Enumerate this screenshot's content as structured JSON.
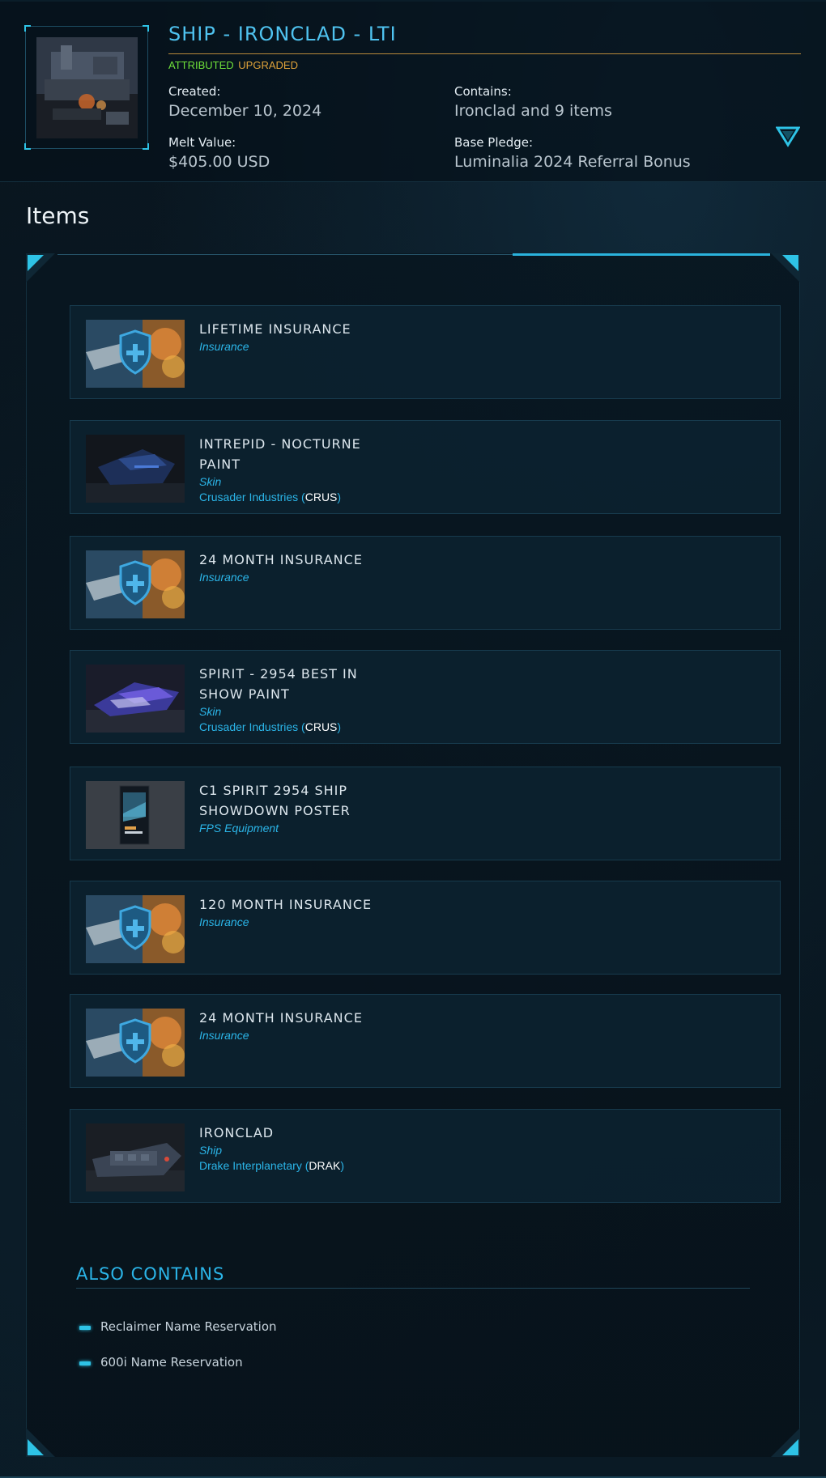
{
  "pledge": {
    "title": "SHIP - IRONCLAD - LTI",
    "tags": {
      "attributed": "ATTRIBUTED",
      "upgraded": "UPGRADED"
    },
    "created_label": "Created:",
    "created_value": "December 10, 2024",
    "contains_label": "Contains:",
    "contains_value": "Ironclad and 9 items",
    "melt_label": "Melt Value:",
    "melt_value": "$405.00 USD",
    "base_label": "Base Pledge:",
    "base_value": "Luminalia 2024 Referral Bonus",
    "toggle_icon": "triangle-down-icon"
  },
  "items_heading": "Items",
  "items": [
    {
      "name_lines": [
        "LIFETIME INSURANCE"
      ],
      "type": "Insurance",
      "manufacturer": "",
      "code": "",
      "image": "insurance-shield"
    },
    {
      "name_lines": [
        "INTREPID - NOCTURNE",
        "PAINT"
      ],
      "type": "Skin",
      "manufacturer": "Crusader Industries (",
      "code": "CRUS",
      "manufacturer_end": ")",
      "image": "intrepid-paint"
    },
    {
      "name_lines": [
        "24 MONTH INSURANCE"
      ],
      "type": "Insurance",
      "manufacturer": "",
      "code": "",
      "image": "insurance-shield"
    },
    {
      "name_lines": [
        "SPIRIT - 2954 BEST IN",
        "SHOW PAINT"
      ],
      "type": "Skin",
      "manufacturer": "Crusader Industries (",
      "code": "CRUS",
      "manufacturer_end": ")",
      "image": "spirit-paint"
    },
    {
      "name_lines": [
        "C1 SPIRIT 2954 SHIP",
        "SHOWDOWN POSTER"
      ],
      "type": "FPS Equipment",
      "manufacturer": "",
      "code": "",
      "image": "poster"
    },
    {
      "name_lines": [
        "120 MONTH INSURANCE"
      ],
      "type": "Insurance",
      "manufacturer": "",
      "code": "",
      "image": "insurance-shield"
    },
    {
      "name_lines": [
        "24 MONTH INSURANCE"
      ],
      "type": "Insurance",
      "manufacturer": "",
      "code": "",
      "image": "insurance-shield"
    },
    {
      "name_lines": [
        "IRONCLAD"
      ],
      "type": "Ship",
      "manufacturer": "Drake Interplanetary (",
      "code": "DRAK",
      "manufacturer_end": ")",
      "image": "ironclad-ship"
    }
  ],
  "also_contains": {
    "heading": "ALSO CONTAINS",
    "entries": [
      "Reclaimer Name Reservation",
      "600i Name Reservation"
    ]
  },
  "colors": {
    "accent": "#2bb5e8",
    "title": "#4fc3f0",
    "attributed": "#6fe03a",
    "upgraded": "#e0a33a",
    "rule": "#b8893a"
  }
}
